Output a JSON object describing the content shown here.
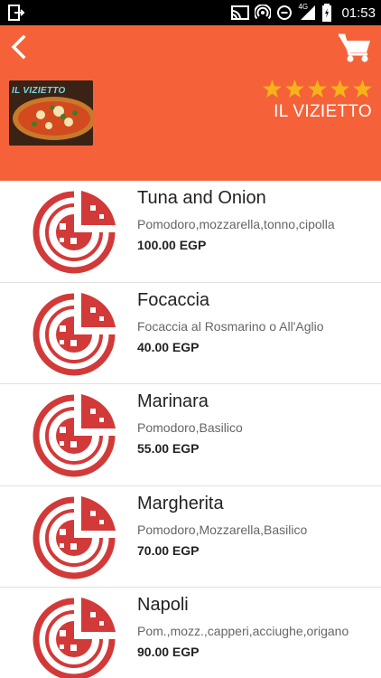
{
  "status_bar": {
    "network": "4G",
    "time": "01:53"
  },
  "header": {
    "back_icon": "chevron-left-icon",
    "cart_icon": "shopping-cart-icon",
    "logo_text": "IL VIZIETTO",
    "rating": 5,
    "rating_max": 5,
    "restaurant_name": "IL VIZIETTO",
    "background_color": "#f5623a",
    "star_color": "#f5b21a"
  },
  "menu_items": [
    {
      "name": "Tuna and Onion",
      "description": "Pomodoro,mozzarella,tonno,cipolla",
      "price": "100.00 EGP"
    },
    {
      "name": "Focaccia",
      "description": "Focaccia al Rosmarino o All'Aglio",
      "price": "40.00 EGP"
    },
    {
      "name": "Marinara",
      "description": "Pomodoro,Basilico",
      "price": "55.00 EGP"
    },
    {
      "name": "Margherita",
      "description": "Pomodoro,Mozzarella,Basilico",
      "price": "70.00 EGP"
    },
    {
      "name": "Napoli",
      "description": "Pom.,mozz.,capperi,acciughe,origano",
      "price": "90.00 EGP"
    }
  ],
  "colors": {
    "pizza_icon": "#d13a38"
  }
}
